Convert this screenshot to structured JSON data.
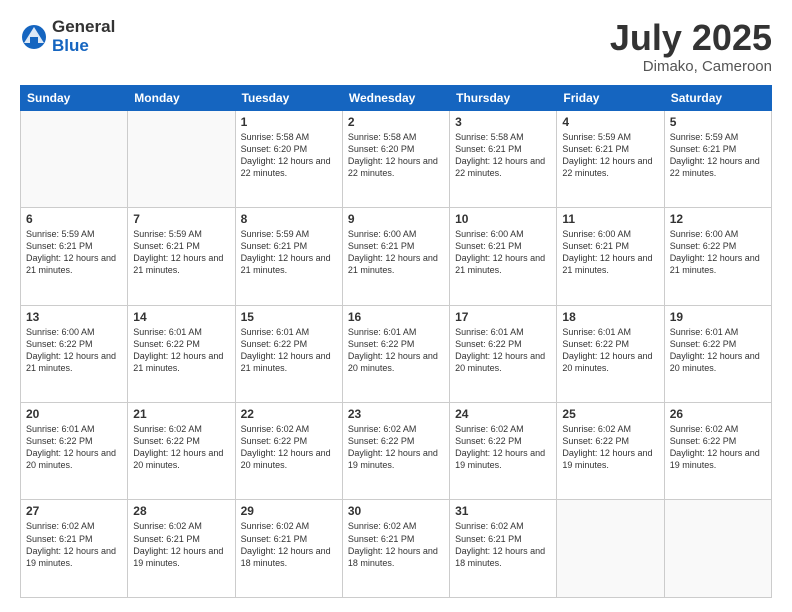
{
  "logo": {
    "general": "General",
    "blue": "Blue"
  },
  "title": {
    "month": "July 2025",
    "location": "Dimako, Cameroon"
  },
  "weekdays": [
    "Sunday",
    "Monday",
    "Tuesday",
    "Wednesday",
    "Thursday",
    "Friday",
    "Saturday"
  ],
  "weeks": [
    [
      {
        "day": "",
        "info": ""
      },
      {
        "day": "",
        "info": ""
      },
      {
        "day": "1",
        "info": "Sunrise: 5:58 AM\nSunset: 6:20 PM\nDaylight: 12 hours and 22 minutes."
      },
      {
        "day": "2",
        "info": "Sunrise: 5:58 AM\nSunset: 6:20 PM\nDaylight: 12 hours and 22 minutes."
      },
      {
        "day": "3",
        "info": "Sunrise: 5:58 AM\nSunset: 6:21 PM\nDaylight: 12 hours and 22 minutes."
      },
      {
        "day": "4",
        "info": "Sunrise: 5:59 AM\nSunset: 6:21 PM\nDaylight: 12 hours and 22 minutes."
      },
      {
        "day": "5",
        "info": "Sunrise: 5:59 AM\nSunset: 6:21 PM\nDaylight: 12 hours and 22 minutes."
      }
    ],
    [
      {
        "day": "6",
        "info": "Sunrise: 5:59 AM\nSunset: 6:21 PM\nDaylight: 12 hours and 21 minutes."
      },
      {
        "day": "7",
        "info": "Sunrise: 5:59 AM\nSunset: 6:21 PM\nDaylight: 12 hours and 21 minutes."
      },
      {
        "day": "8",
        "info": "Sunrise: 5:59 AM\nSunset: 6:21 PM\nDaylight: 12 hours and 21 minutes."
      },
      {
        "day": "9",
        "info": "Sunrise: 6:00 AM\nSunset: 6:21 PM\nDaylight: 12 hours and 21 minutes."
      },
      {
        "day": "10",
        "info": "Sunrise: 6:00 AM\nSunset: 6:21 PM\nDaylight: 12 hours and 21 minutes."
      },
      {
        "day": "11",
        "info": "Sunrise: 6:00 AM\nSunset: 6:21 PM\nDaylight: 12 hours and 21 minutes."
      },
      {
        "day": "12",
        "info": "Sunrise: 6:00 AM\nSunset: 6:22 PM\nDaylight: 12 hours and 21 minutes."
      }
    ],
    [
      {
        "day": "13",
        "info": "Sunrise: 6:00 AM\nSunset: 6:22 PM\nDaylight: 12 hours and 21 minutes."
      },
      {
        "day": "14",
        "info": "Sunrise: 6:01 AM\nSunset: 6:22 PM\nDaylight: 12 hours and 21 minutes."
      },
      {
        "day": "15",
        "info": "Sunrise: 6:01 AM\nSunset: 6:22 PM\nDaylight: 12 hours and 21 minutes."
      },
      {
        "day": "16",
        "info": "Sunrise: 6:01 AM\nSunset: 6:22 PM\nDaylight: 12 hours and 20 minutes."
      },
      {
        "day": "17",
        "info": "Sunrise: 6:01 AM\nSunset: 6:22 PM\nDaylight: 12 hours and 20 minutes."
      },
      {
        "day": "18",
        "info": "Sunrise: 6:01 AM\nSunset: 6:22 PM\nDaylight: 12 hours and 20 minutes."
      },
      {
        "day": "19",
        "info": "Sunrise: 6:01 AM\nSunset: 6:22 PM\nDaylight: 12 hours and 20 minutes."
      }
    ],
    [
      {
        "day": "20",
        "info": "Sunrise: 6:01 AM\nSunset: 6:22 PM\nDaylight: 12 hours and 20 minutes."
      },
      {
        "day": "21",
        "info": "Sunrise: 6:02 AM\nSunset: 6:22 PM\nDaylight: 12 hours and 20 minutes."
      },
      {
        "day": "22",
        "info": "Sunrise: 6:02 AM\nSunset: 6:22 PM\nDaylight: 12 hours and 20 minutes."
      },
      {
        "day": "23",
        "info": "Sunrise: 6:02 AM\nSunset: 6:22 PM\nDaylight: 12 hours and 19 minutes."
      },
      {
        "day": "24",
        "info": "Sunrise: 6:02 AM\nSunset: 6:22 PM\nDaylight: 12 hours and 19 minutes."
      },
      {
        "day": "25",
        "info": "Sunrise: 6:02 AM\nSunset: 6:22 PM\nDaylight: 12 hours and 19 minutes."
      },
      {
        "day": "26",
        "info": "Sunrise: 6:02 AM\nSunset: 6:22 PM\nDaylight: 12 hours and 19 minutes."
      }
    ],
    [
      {
        "day": "27",
        "info": "Sunrise: 6:02 AM\nSunset: 6:21 PM\nDaylight: 12 hours and 19 minutes."
      },
      {
        "day": "28",
        "info": "Sunrise: 6:02 AM\nSunset: 6:21 PM\nDaylight: 12 hours and 19 minutes."
      },
      {
        "day": "29",
        "info": "Sunrise: 6:02 AM\nSunset: 6:21 PM\nDaylight: 12 hours and 18 minutes."
      },
      {
        "day": "30",
        "info": "Sunrise: 6:02 AM\nSunset: 6:21 PM\nDaylight: 12 hours and 18 minutes."
      },
      {
        "day": "31",
        "info": "Sunrise: 6:02 AM\nSunset: 6:21 PM\nDaylight: 12 hours and 18 minutes."
      },
      {
        "day": "",
        "info": ""
      },
      {
        "day": "",
        "info": ""
      }
    ]
  ]
}
